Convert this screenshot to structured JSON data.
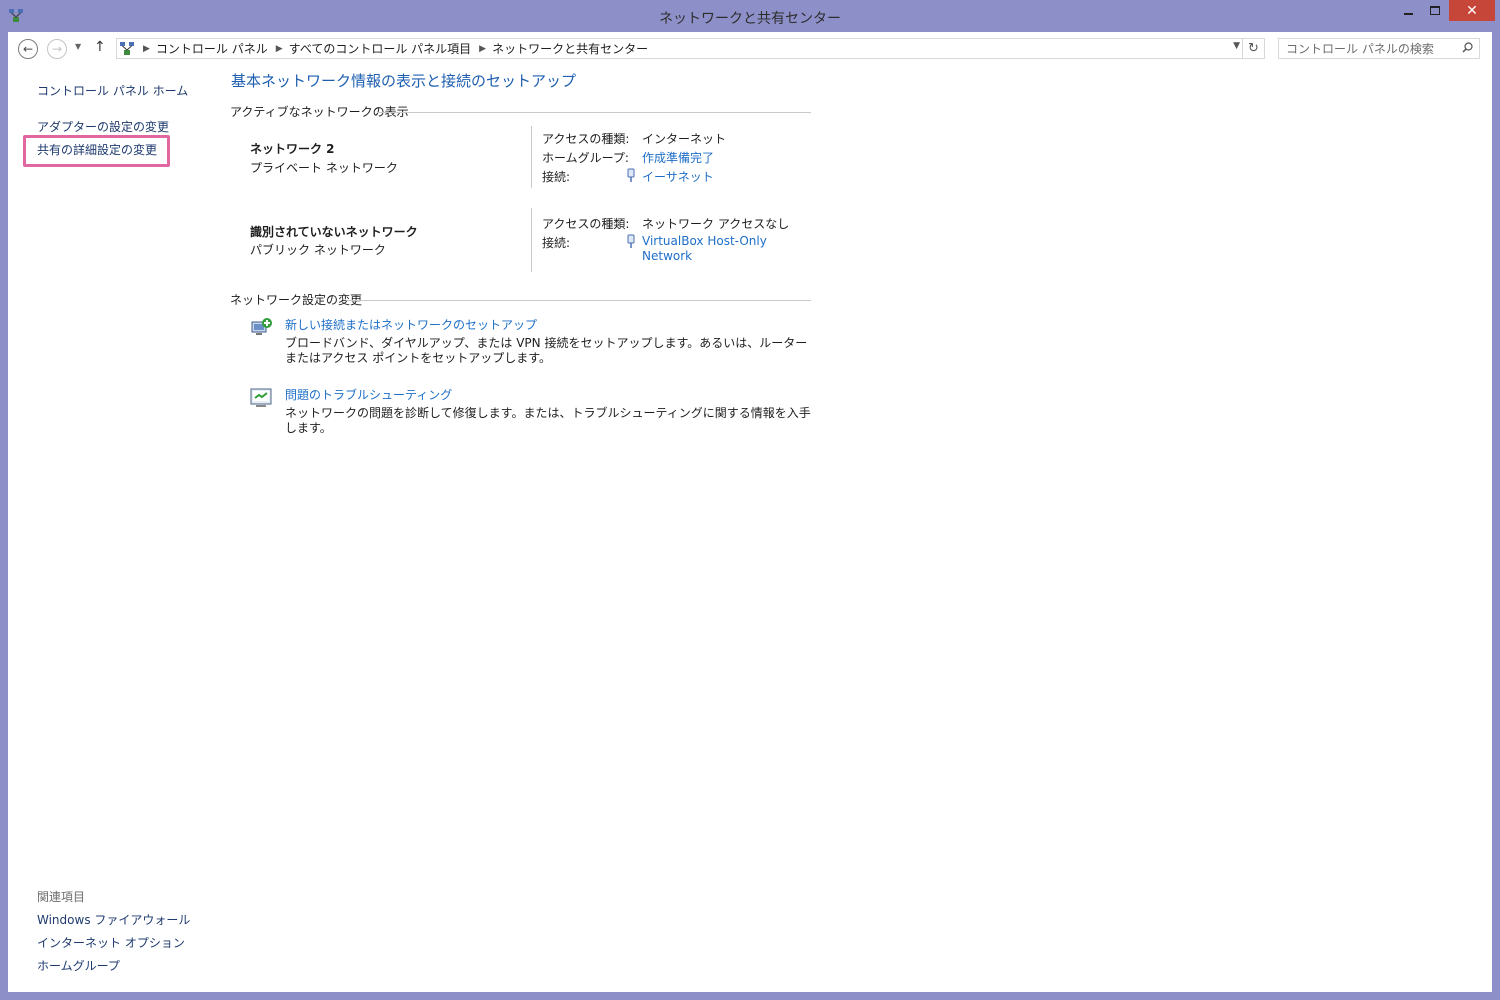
{
  "window": {
    "title": "ネットワークと共有センター",
    "close_glyph": "✕"
  },
  "nav": {
    "back_glyph": "←",
    "forward_glyph": "→",
    "recent_glyph": "▼",
    "up_glyph": "↑",
    "breadcrumbs": [
      "コントロール パネル",
      "すべてのコントロール パネル項目",
      "ネットワークと共有センター"
    ],
    "crumb_separator": "▶",
    "dropdown_glyph": "▼",
    "refresh_glyph": "↻",
    "search_placeholder": "コントロール パネルの検索"
  },
  "sidebar": {
    "home": "コントロール パネル ホーム",
    "links": [
      "アダプターの設定の変更",
      "共有の詳細設定の変更"
    ],
    "related_heading": "関連項目",
    "related": [
      "Windows ファイアウォール",
      "インターネット オプション",
      "ホームグループ"
    ]
  },
  "main": {
    "title": "基本ネットワーク情報の表示と接続のセットアップ",
    "active_section": "アクティブなネットワークの表示",
    "networks": [
      {
        "name": "ネットワーク 2",
        "type": "プライベート ネットワーク",
        "access_label": "アクセスの種類:",
        "access_value": "インターネット",
        "homegroup_label": "ホームグループ:",
        "homegroup_value": "作成準備完了",
        "connection_label": "接続:",
        "connection_value": "イーサネット"
      },
      {
        "name": "識別されていないネットワーク",
        "type": "パブリック ネットワーク",
        "access_label": "アクセスの種類:",
        "access_value": "ネットワーク アクセスなし",
        "connection_label": "接続:",
        "connection_value_line1": "VirtualBox Host-Only",
        "connection_value_line2": "Network"
      }
    ],
    "settings_section": "ネットワーク設定の変更",
    "tasks": [
      {
        "link": "新しい接続またはネットワークのセットアップ",
        "desc": "ブロードバンド、ダイヤルアップ、または VPN 接続をセットアップします。あるいは、ルーターまたはアクセス ポイントをセットアップします。"
      },
      {
        "link": "問題のトラブルシューティング",
        "desc": "ネットワークの問題を診断して修復します。または、トラブルシューティングに関する情報を入手します。"
      }
    ]
  },
  "colors": {
    "window_frame": "#8d90c8",
    "link_blue": "#1e6fc8",
    "title_blue": "#1e5fb0",
    "highlight": "#e0679f",
    "close_red": "#c7463a"
  }
}
